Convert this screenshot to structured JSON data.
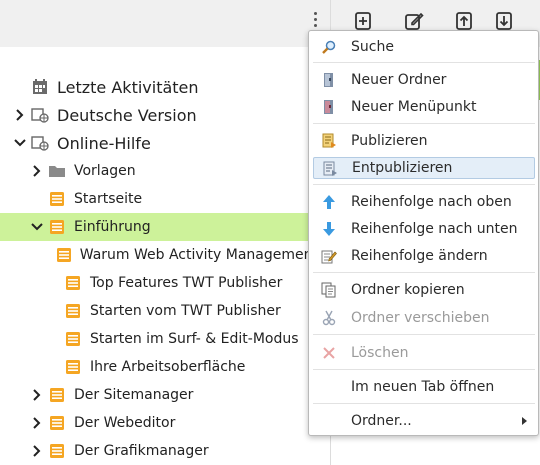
{
  "tree": {
    "items": [
      {
        "label": "Letzte Aktivitäten"
      },
      {
        "label": "Deutsche Version"
      },
      {
        "label": "Online-Hilfe"
      },
      {
        "label": "Vorlagen"
      },
      {
        "label": "Startseite"
      },
      {
        "label": "Einführung"
      },
      {
        "label": "Warum Web Activity Management"
      },
      {
        "label": "Top Features TWT Publisher"
      },
      {
        "label": "Starten vom TWT Publisher"
      },
      {
        "label": "Starten im Surf- & Edit-Modus"
      },
      {
        "label": "Ihre Arbeitsoberfläche"
      },
      {
        "label": "Der Sitemanager"
      },
      {
        "label": "Der Webeditor"
      },
      {
        "label": "Der Grafikmanager"
      }
    ]
  },
  "context_menu": {
    "items": [
      {
        "label": "Suche",
        "icon": "magnifier-icon"
      },
      {
        "label": "Neuer Ordner",
        "icon": "new-folder-icon"
      },
      {
        "label": "Neuer Menüpunkt",
        "icon": "new-menu-item-icon"
      },
      {
        "label": "Publizieren",
        "icon": "publish-icon"
      },
      {
        "label": "Entpublizieren",
        "icon": "unpublish-icon"
      },
      {
        "label": "Reihenfolge nach oben",
        "icon": "arrow-up-icon"
      },
      {
        "label": "Reihenfolge nach unten",
        "icon": "arrow-down-icon"
      },
      {
        "label": "Reihenfolge ändern",
        "icon": "edit-order-icon"
      },
      {
        "label": "Ordner kopieren",
        "icon": "copy-icon"
      },
      {
        "label": "Ordner verschieben",
        "icon": "scissors-icon"
      },
      {
        "label": "Löschen",
        "icon": "delete-x-icon"
      },
      {
        "label": "Im neuen Tab öffnen"
      },
      {
        "label": "Ordner..."
      }
    ]
  },
  "colors": {
    "selected_row": "#cdf29a",
    "page_icon_orange": "#f5a623",
    "menu_highlight": "#e4eef8"
  }
}
